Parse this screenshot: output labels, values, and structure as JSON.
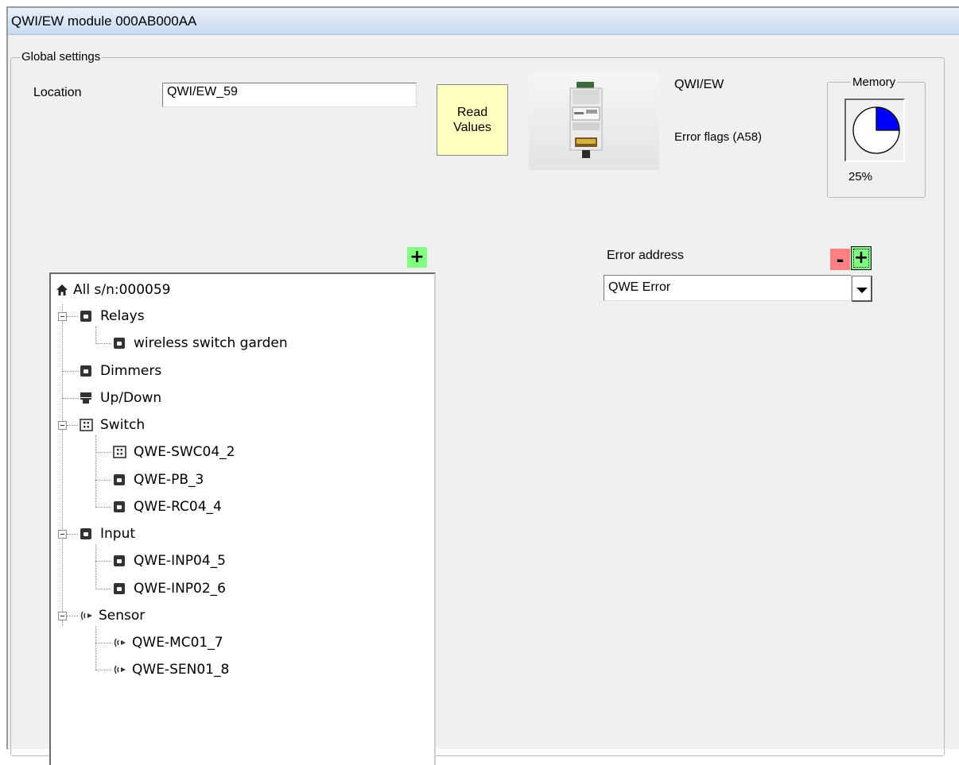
{
  "window": {
    "title": "QWI/EW module 000AB000AA"
  },
  "global_settings": {
    "legend": "Global settings",
    "location_label": "Location",
    "location_value": "QWI/EW_59",
    "read_values_label": "Read\nValues",
    "device_name": "QWI/EW",
    "error_flags_label": "Error flags (A58)"
  },
  "memory": {
    "legend": "Memory",
    "percent_label": "25%",
    "percent_value": 25,
    "fill_color": "#0000ff"
  },
  "error_address": {
    "label": "Error address",
    "value": "QWE Error",
    "remove_label": "-",
    "add_label": "+"
  },
  "tree": {
    "add_label": "+",
    "root": "All s/n:000059",
    "items": [
      {
        "label": "Relays",
        "icon": "module-icon"
      },
      {
        "label": "wireless switch garden",
        "icon": "module-icon"
      },
      {
        "label": "Dimmers",
        "icon": "module-icon"
      },
      {
        "label": "Up/Down",
        "icon": "shutter-icon"
      },
      {
        "label": "Switch",
        "icon": "keypad-icon"
      },
      {
        "label": "QWE-SWC04_2",
        "icon": "keypad-icon"
      },
      {
        "label": "QWE-PB_3",
        "icon": "module-icon"
      },
      {
        "label": "QWE-RC04_4",
        "icon": "module-icon"
      },
      {
        "label": "Input",
        "icon": "module-icon"
      },
      {
        "label": "QWE-INP04_5",
        "icon": "module-icon"
      },
      {
        "label": "QWE-INP02_6",
        "icon": "module-icon"
      },
      {
        "label": "Sensor",
        "icon": "sensor-icon"
      },
      {
        "label": "QWE-MC01_7",
        "icon": "sensor-icon"
      },
      {
        "label": "QWE-SEN01_8",
        "icon": "sensor-icon"
      }
    ]
  },
  "colors": {
    "add_button": "#80ff80",
    "remove_button": "#ff8080",
    "read_button": "#ffffc0",
    "title_bar": "#d7e4f4"
  }
}
